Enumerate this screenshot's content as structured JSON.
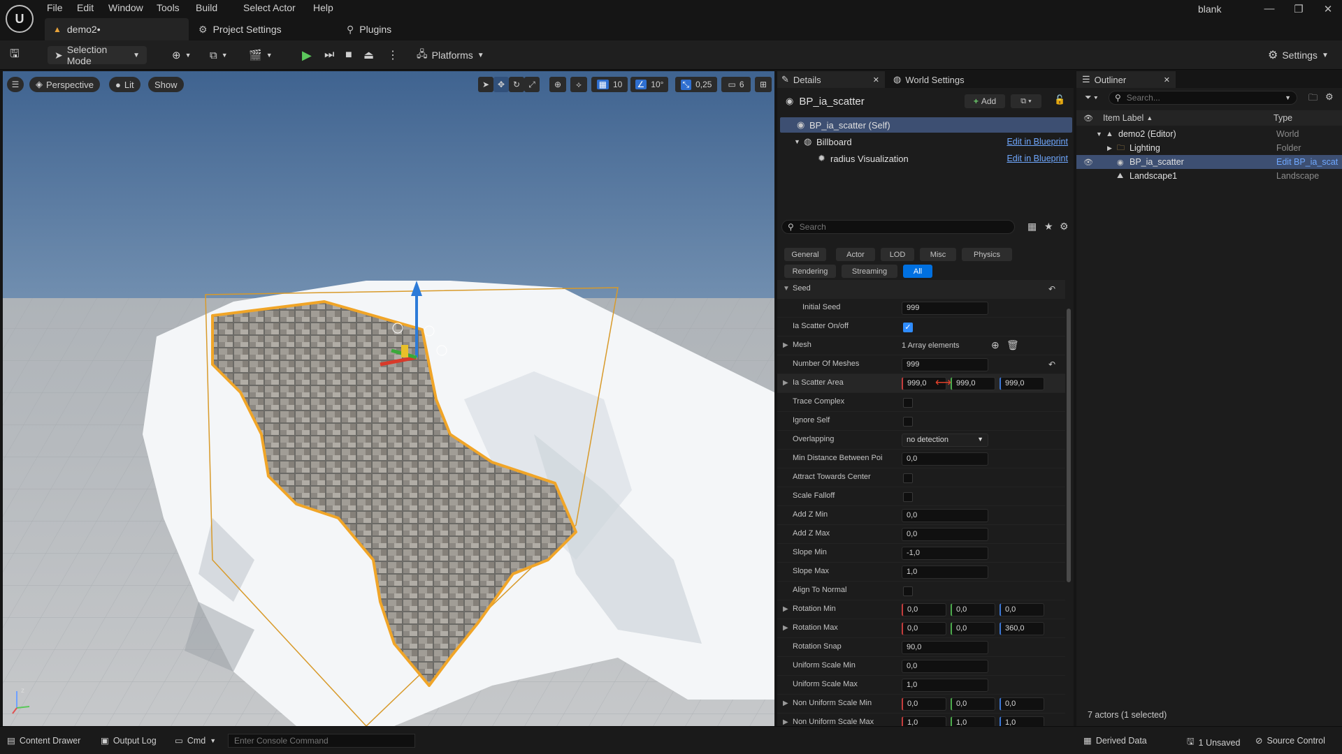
{
  "menu": [
    "File",
    "Edit",
    "Window",
    "Tools",
    "Build",
    "Select",
    "Actor",
    "Help"
  ],
  "tabs": {
    "level": "demo2•",
    "project_settings": "Project Settings",
    "plugins": "Plugins"
  },
  "window": {
    "project": "blank"
  },
  "toolbar": {
    "selection_mode": "Selection Mode",
    "platforms": "Platforms",
    "settings": "Settings"
  },
  "viewport": {
    "perspective": "Perspective",
    "lit": "Lit",
    "show": "Show",
    "grid_snap": "10",
    "rotation_snap": "10°",
    "scale_snap": "0,25",
    "camera_speed": "6"
  },
  "details": {
    "tab_details": "Details",
    "tab_world_settings": "World Settings",
    "actor_name": "BP_ia_scatter",
    "add_label": "Add",
    "components": [
      {
        "name": "BP_ia_scatter (Self)",
        "link": ""
      },
      {
        "name": "Billboard",
        "link": "Edit in Blueprint"
      },
      {
        "name": "radius Visualization",
        "link": "Edit in Blueprint"
      }
    ],
    "search_placeholder": "Search",
    "filters": [
      "General",
      "Actor",
      "LOD",
      "Misc",
      "Physics",
      "Rendering",
      "Streaming",
      "All"
    ],
    "section": "Seed",
    "props": [
      {
        "label": "Initial Seed",
        "type": "text",
        "value": "999"
      },
      {
        "label": "Ia Scatter On/off",
        "type": "check",
        "checked": true
      },
      {
        "label": "Mesh",
        "type": "array",
        "value": "1 Array elements"
      },
      {
        "label": "Number Of Meshes",
        "type": "text",
        "value": "999"
      },
      {
        "label": "Ia Scatter Area",
        "type": "vec",
        "values": [
          "999,0",
          "999,0",
          "999,0"
        ]
      },
      {
        "label": "Trace Complex",
        "type": "check",
        "checked": false
      },
      {
        "label": "Ignore Self",
        "type": "check",
        "checked": false
      },
      {
        "label": "Overlapping",
        "type": "select",
        "value": "no detection"
      },
      {
        "label": "Min Distance Between Poi...",
        "type": "text",
        "value": "0,0"
      },
      {
        "label": "Attract Towards Center",
        "type": "check",
        "checked": false
      },
      {
        "label": "Scale Falloff",
        "type": "check",
        "checked": false
      },
      {
        "label": "Add Z Min",
        "type": "text",
        "value": "0,0"
      },
      {
        "label": "Add Z Max",
        "type": "text",
        "value": "0,0"
      },
      {
        "label": "Slope Min",
        "type": "text",
        "value": "-1,0"
      },
      {
        "label": "Slope Max",
        "type": "text",
        "value": "1,0"
      },
      {
        "label": "Align To Normal",
        "type": "check",
        "checked": false
      },
      {
        "label": "Rotation Min",
        "type": "vec",
        "values": [
          "0,0",
          "0,0",
          "0,0"
        ]
      },
      {
        "label": "Rotation Max",
        "type": "vec",
        "values": [
          "0,0",
          "0,0",
          "360,0"
        ]
      },
      {
        "label": "Rotation Snap",
        "type": "text",
        "value": "90,0"
      },
      {
        "label": "Uniform Scale Min",
        "type": "text",
        "value": "0,0"
      },
      {
        "label": "Uniform Scale Max",
        "type": "text",
        "value": "1,0"
      },
      {
        "label": "Non Uniform Scale Min",
        "type": "vec",
        "values": [
          "0,0",
          "0,0",
          "0,0"
        ]
      },
      {
        "label": "Non Uniform Scale Max",
        "type": "vec",
        "values": [
          "1,0",
          "1,0",
          "1,0"
        ]
      }
    ]
  },
  "outliner": {
    "title": "Outliner",
    "search_placeholder": "Search...",
    "col_label": "Item Label",
    "col_type": "Type",
    "items": [
      {
        "label": "demo2 (Editor)",
        "type": "World"
      },
      {
        "label": "Lighting",
        "type": "Folder"
      },
      {
        "label": "BP_ia_scatter",
        "type": "Edit BP_ia_scat"
      },
      {
        "label": "Landscape1",
        "type": "Landscape"
      }
    ],
    "status": "7 actors (1 selected)"
  },
  "statusbar": {
    "content_drawer": "Content Drawer",
    "output_log": "Output Log",
    "cmd": "Cmd",
    "console_placeholder": "Enter Console Command",
    "derived_data": "Derived Data",
    "unsaved": "1 Unsaved",
    "source_control": "Source Control"
  },
  "colors": {
    "accent": "#0070e0",
    "selection": "#3d4f72",
    "link": "#6fa8ff",
    "checkbox": "#2f8cff"
  }
}
